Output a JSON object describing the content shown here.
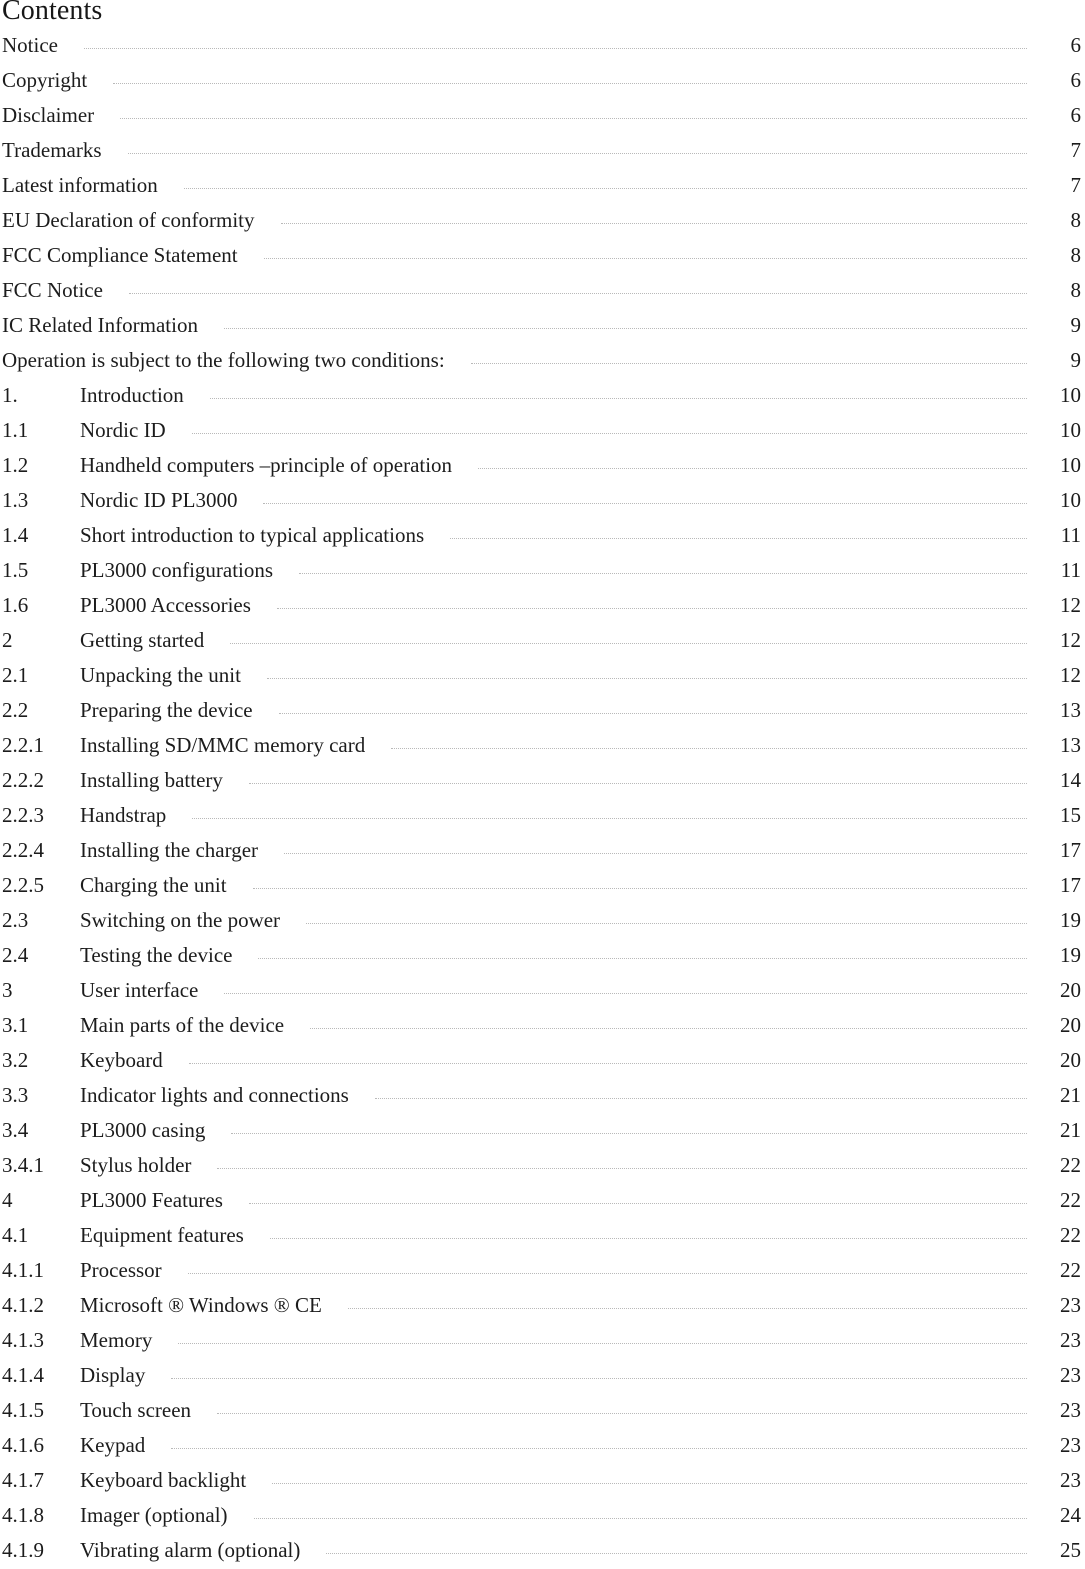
{
  "document": {
    "heading": "Contents"
  },
  "entries": [
    {
      "number": "",
      "label": "Notice",
      "page": "6"
    },
    {
      "number": "",
      "label": "Copyright",
      "page": "6"
    },
    {
      "number": "",
      "label": "Disclaimer",
      "page": "6"
    },
    {
      "number": "",
      "label": "Trademarks",
      "page": "7"
    },
    {
      "number": "",
      "label": "Latest information",
      "page": "7"
    },
    {
      "number": "",
      "label": "EU Declaration of conformity",
      "page": "8"
    },
    {
      "number": "",
      "label": "FCC Compliance Statement",
      "page": "8"
    },
    {
      "number": "",
      "label": "FCC Notice",
      "page": "8"
    },
    {
      "number": "",
      "label": "IC Related Information",
      "page": "9"
    },
    {
      "number": "",
      "label": "Operation is subject to the following two conditions:",
      "page": "9"
    },
    {
      "number": "1.",
      "label": "Introduction",
      "page": "10"
    },
    {
      "number": "1.1",
      "label": "Nordic ID",
      "page": "10"
    },
    {
      "number": "1.2",
      "label": "Handheld computers –principle of operation",
      "page": "10"
    },
    {
      "number": "1.3",
      "label": "Nordic ID PL3000",
      "page": "10"
    },
    {
      "number": "1.4",
      "label": "Short introduction to typical applications",
      "page": "11"
    },
    {
      "number": "1.5",
      "label": "PL3000 configurations",
      "page": "11"
    },
    {
      "number": "1.6",
      "label": "PL3000 Accessories",
      "page": "12"
    },
    {
      "number": "2",
      "label": "Getting started",
      "page": "12"
    },
    {
      "number": "2.1",
      "label": "Unpacking the unit",
      "page": "12"
    },
    {
      "number": "2.2",
      "label": "Preparing the device",
      "page": "13"
    },
    {
      "number": "2.2.1",
      "label": "Installing SD/MMC memory card",
      "page": "13"
    },
    {
      "number": "2.2.2",
      "label": "Installing battery",
      "page": "14"
    },
    {
      "number": "2.2.3",
      "label": "Handstrap",
      "page": "15"
    },
    {
      "number": "2.2.4",
      "label": "Installing the charger",
      "page": "17"
    },
    {
      "number": "2.2.5",
      "label": "Charging the unit",
      "page": "17"
    },
    {
      "number": "2.3",
      "label": "Switching on the power",
      "page": "19"
    },
    {
      "number": "2.4",
      "label": "Testing the device",
      "page": "19"
    },
    {
      "number": "3",
      "label": "User interface",
      "page": "20"
    },
    {
      "number": "3.1",
      "label": "Main parts of the device",
      "page": "20"
    },
    {
      "number": "3.2",
      "label": "Keyboard",
      "page": "20"
    },
    {
      "number": "3.3",
      "label": "Indicator lights and connections",
      "page": "21"
    },
    {
      "number": "3.4",
      "label": "PL3000 casing",
      "page": "21"
    },
    {
      "number": "3.4.1",
      "label": "Stylus holder",
      "page": "22"
    },
    {
      "number": "4",
      "label": "PL3000 Features",
      "page": "22"
    },
    {
      "number": "4.1",
      "label": "Equipment features",
      "page": "22"
    },
    {
      "number": "4.1.1",
      "label": "Processor",
      "page": "22"
    },
    {
      "number": "4.1.2",
      "label": "Microsoft ® Windows ® CE",
      "page": "23"
    },
    {
      "number": "4.1.3",
      "label": "Memory",
      "page": "23"
    },
    {
      "number": "4.1.4",
      "label": "Display",
      "page": "23"
    },
    {
      "number": "4.1.5",
      "label": "Touch screen",
      "page": "23"
    },
    {
      "number": "4.1.6",
      "label": "Keypad",
      "page": "23"
    },
    {
      "number": "4.1.7",
      "label": "Keyboard backlight",
      "page": "23"
    },
    {
      "number": "4.1.8",
      "label": "Imager (optional)",
      "page": "24"
    },
    {
      "number": "4.1.9",
      "label": "Vibrating alarm (optional)",
      "page": "25"
    }
  ],
  "colors": {
    "text": "#1c1c1c",
    "leader": "#b9b9b9",
    "background": "#ffffff"
  }
}
